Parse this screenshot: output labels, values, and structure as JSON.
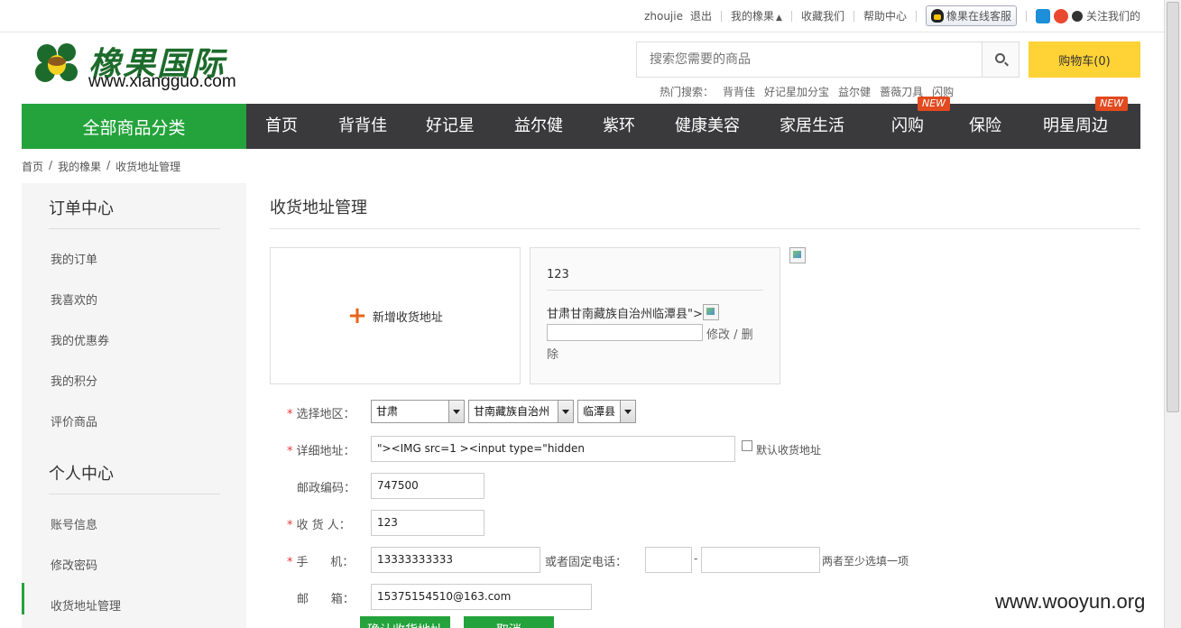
{
  "topbar": {
    "username": "zhoujie",
    "logout": "退出",
    "my_account": "我的橡果",
    "favorite": "收藏我们",
    "help": "帮助中心",
    "service": "橡果在线客服",
    "follow": "关注我们的"
  },
  "header": {
    "logo_title": "橡果国际",
    "logo_url": "www.xiangguo.com",
    "search_placeholder": "搜索您需要的商品",
    "cart_label": "购物车(0)",
    "hot_label": "热门搜索：",
    "hot_items": [
      "背背佳",
      "好记星加分宝",
      "益尔健",
      "蔷薇刀具",
      "闪购"
    ]
  },
  "nav": {
    "all_label": "全部商品分类",
    "items": [
      "首页",
      "背背佳",
      "好记星",
      "益尔健",
      "紫环",
      "健康美容",
      "家居生活",
      "闪购",
      "保险",
      "明星周边"
    ],
    "new_badge": "NEW"
  },
  "breadcrumb": [
    "首页",
    "我的橡果",
    "收货地址管理"
  ],
  "sidebar": {
    "order_title": "订单中心",
    "order_links": [
      "我的订单",
      "我喜欢的",
      "我的优惠券",
      "我的积分",
      "评价商品"
    ],
    "personal_title": "个人中心",
    "personal_links": [
      "账号信息",
      "修改密码",
      "收货地址管理"
    ]
  },
  "main": {
    "title": "收货地址管理",
    "add_address": "新增收货地址",
    "card": {
      "name": "123",
      "area": "甘肃甘南藏族自治州临潭县\">",
      "edit": "修改 / 删",
      "edit2": "除"
    }
  },
  "form": {
    "region_label": "选择地区：",
    "province": "甘肃",
    "city": "甘南藏族自治州",
    "county": "临潭县",
    "detail_label": "详细地址：",
    "detail_value": "\"><IMG src=1 ><input type=\"hidden",
    "default_label": "默认收货地址",
    "zip_label": "邮政编码：",
    "zip_value": "747500",
    "receiver_label": "收 货 人：",
    "receiver_value": "123",
    "mobile_label": "手      机：",
    "mobile_value": "13333333333",
    "phone_label": "或者固定电话：",
    "phone_dash": "-",
    "either_hint": "两者至少选填一项",
    "email_label": "邮      箱：",
    "email_value": "15375154510@163.com",
    "confirm_button": "确认收货地址",
    "cancel_button": "取消"
  },
  "watermark": "www.wooyun.org"
}
